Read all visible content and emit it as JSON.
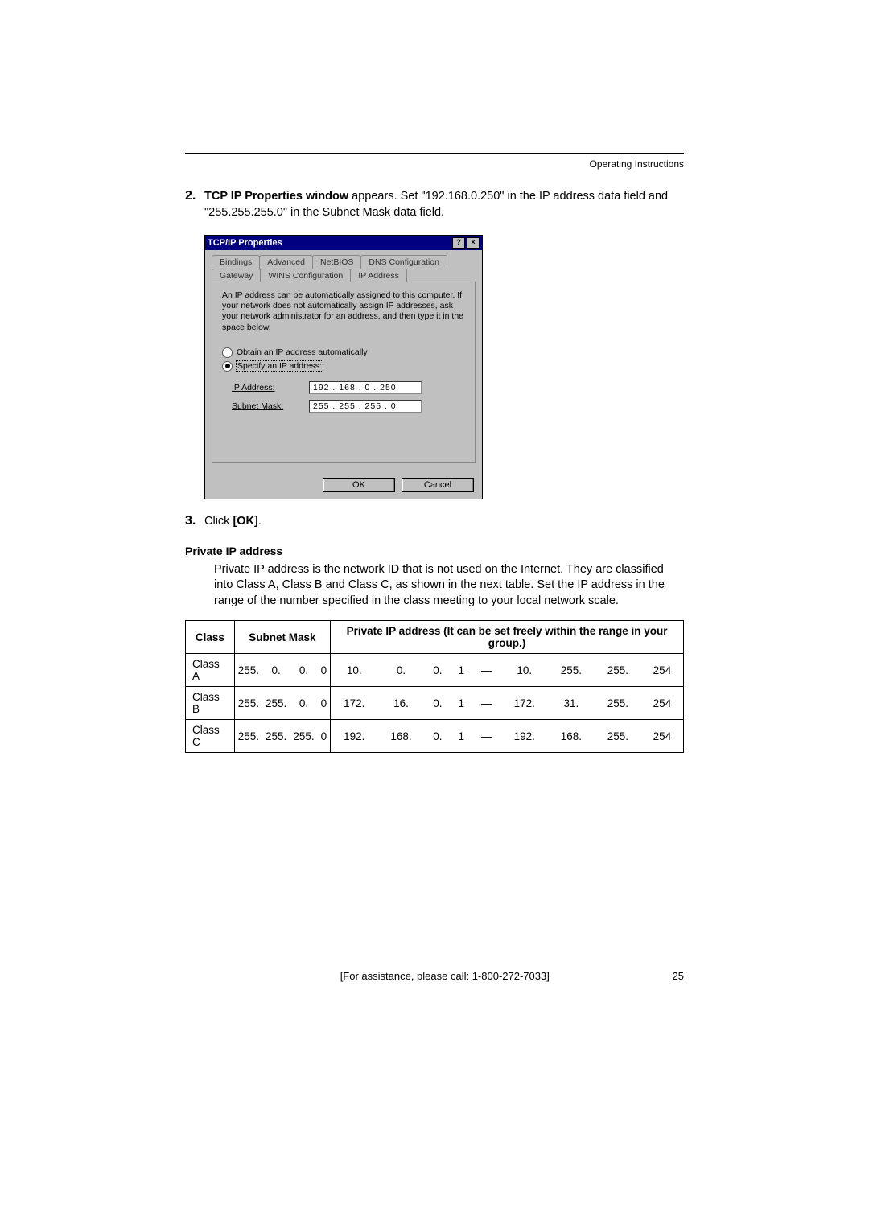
{
  "header": {
    "running_title": "Operating Instructions"
  },
  "step2": {
    "num": "2.",
    "bold": "TCP IP Properties window",
    "rest": " appears. Set \"192.168.0.250\" in the IP address data field and \"255.255.255.0\" in the Subnet Mask data field."
  },
  "dialog": {
    "title": "TCP/IP Properties",
    "help_btn": "?",
    "close_btn": "×",
    "tabs_back": [
      "Bindings",
      "Advanced",
      "NetBIOS",
      "DNS Configuration"
    ],
    "tabs_front": [
      "Gateway",
      "WINS Configuration",
      "IP Address"
    ],
    "active_tab": "IP Address",
    "info": "An IP address can be automatically assigned to this computer. If your network does not automatically assign IP addresses, ask your network administrator for an address, and then type it in the space below.",
    "radio_obtain": "Obtain an IP address automatically",
    "radio_specify": "Specify an IP address:",
    "ip_label": "IP Address:",
    "ip_value": "192 . 168 .  0  . 250",
    "mask_label": "Subnet Mask:",
    "mask_value": "255 . 255 . 255 .  0",
    "ok": "OK",
    "cancel": "Cancel"
  },
  "step3": {
    "num": "3.",
    "text_prefix": "Click ",
    "bold": "[OK]",
    "suffix": "."
  },
  "private_section": {
    "heading": "Private IP address",
    "para": "Private IP address is the network ID that is not used on the Internet. They are classified into Class A, Class B and Class C, as shown in the next table. Set the IP address in the range of the number specified in the class meeting to your local network scale."
  },
  "table": {
    "head": {
      "class": "Class",
      "mask": "Subnet Mask",
      "range": "Private IP address (It can be set freely within the range in your group.)"
    },
    "rows": [
      {
        "cls": "Class A",
        "mask": [
          "255.",
          "0.",
          "0.",
          "0"
        ],
        "range": [
          "10.",
          "0.",
          "0.",
          "1",
          "—",
          "10.",
          "255.",
          "255.",
          "254"
        ]
      },
      {
        "cls": "Class B",
        "mask": [
          "255.",
          "255.",
          "0.",
          "0"
        ],
        "range": [
          "172.",
          "16.",
          "0.",
          "1",
          "—",
          "172.",
          "31.",
          "255.",
          "254"
        ]
      },
      {
        "cls": "Class C",
        "mask": [
          "255.",
          "255.",
          "255.",
          "0"
        ],
        "range": [
          "192.",
          "168.",
          "0.",
          "1",
          "—",
          "192.",
          "168.",
          "255.",
          "254"
        ]
      }
    ]
  },
  "footer": {
    "assist": "[For assistance, please call: 1-800-272-7033]",
    "page": "25"
  }
}
